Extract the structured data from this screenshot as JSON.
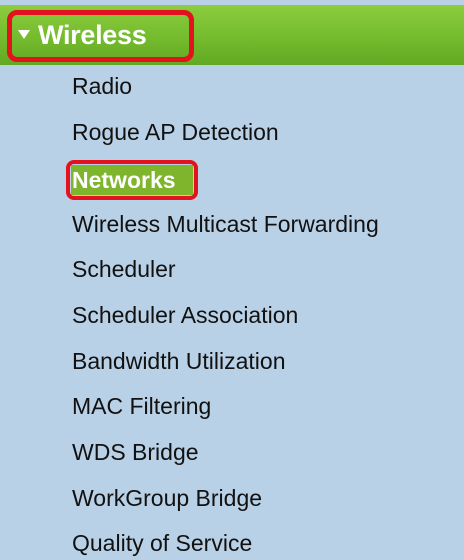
{
  "nav": {
    "section": {
      "title": "Wireless",
      "expanded": true,
      "icon": "caret-down-icon",
      "highlight_color": "#e4111f",
      "header_color": "#74bb2e"
    },
    "active_item": "Networks",
    "items": [
      "Radio",
      "Rogue AP Detection",
      "Networks",
      "Wireless Multicast Forwarding",
      "Scheduler",
      "Scheduler Association",
      "Bandwidth Utilization",
      "MAC Filtering",
      "WDS Bridge",
      "WorkGroup Bridge",
      "Quality of Service"
    ],
    "panel_color": "#b9d1e6"
  }
}
